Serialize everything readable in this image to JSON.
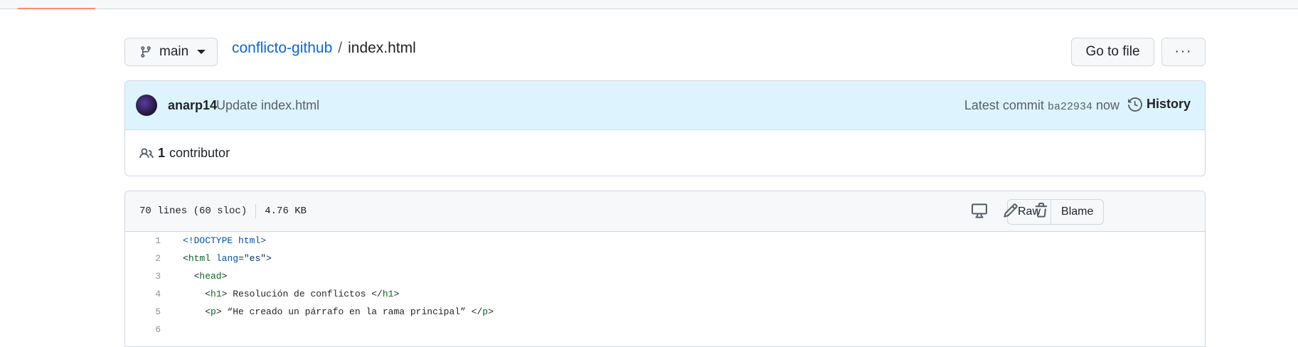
{
  "header": {
    "branch_label": "main",
    "repo_name": "conflicto-github",
    "separator": "/",
    "file_name": "index.html",
    "go_to_file_label": "Go to file",
    "more_label": "···"
  },
  "commit": {
    "author": "anarp14",
    "message": "Update index.html",
    "latest_prefix": "Latest commit",
    "sha": "ba22934",
    "time": "now",
    "history_label": "History"
  },
  "contributors": {
    "count": "1",
    "label": "contributor"
  },
  "file": {
    "lines_info": "70 lines (60 sloc)",
    "size": "4.76 KB",
    "raw_label": "Raw",
    "blame_label": "Blame"
  },
  "code_lines": [
    {
      "num": "1",
      "text": "<!DOCTYPE html>"
    },
    {
      "num": "2",
      "text": "<html lang=\"es\">"
    },
    {
      "num": "3",
      "text": "  <head>"
    },
    {
      "num": "4",
      "text": "    <h1> Resolución de conflictos </h1>"
    },
    {
      "num": "5",
      "text": "    <p> “He creado un párrafo en la rama principal” </p>"
    },
    {
      "num": "6",
      "text": ""
    }
  ],
  "colors": {
    "accent": "#0969da",
    "commit_bar_bg": "#ddf4ff",
    "tab_underline": "#fd8c73"
  }
}
